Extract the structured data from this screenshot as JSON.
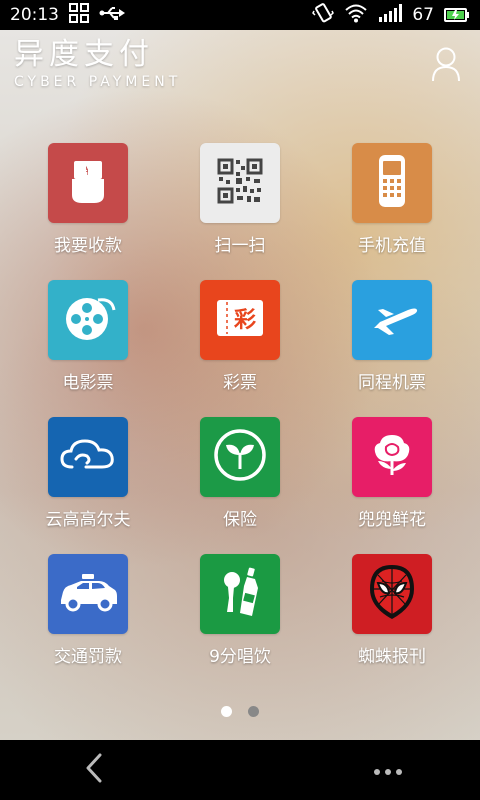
{
  "status_bar": {
    "time": "20:13",
    "battery_level": "67",
    "icons": [
      "qr-grid-icon",
      "usb-icon",
      "vibrate-icon",
      "wifi-icon",
      "signal-icon",
      "battery-icon"
    ]
  },
  "header": {
    "title": "异度支付",
    "subtitle": "CYBER PAYMENT",
    "user_icon": "user-icon"
  },
  "tiles": [
    {
      "label": "我要收款",
      "icon": "hand-money-icon",
      "color": "#c54a4a"
    },
    {
      "label": "扫一扫",
      "icon": "qr-code-icon",
      "color": "#ececec"
    },
    {
      "label": "手机充值",
      "icon": "mobile-phone-icon",
      "color": "#d88c48"
    },
    {
      "label": "电影票",
      "icon": "film-reel-icon",
      "color": "#33b1c9"
    },
    {
      "label": "彩票",
      "icon": "lottery-ticket-icon",
      "color": "#e8451d"
    },
    {
      "label": "同程机票",
      "icon": "airplane-icon",
      "color": "#2aa0df"
    },
    {
      "label": "云高高尔夫",
      "icon": "cloud-icon",
      "color": "#1565b1"
    },
    {
      "label": "保险",
      "icon": "leaf-icon",
      "color": "#1c9a47"
    },
    {
      "label": "兜兜鲜花",
      "icon": "rose-icon",
      "color": "#e71e67"
    },
    {
      "label": "交通罚款",
      "icon": "taxi-car-icon",
      "color": "#3b6bc8"
    },
    {
      "label": "9分唱饮",
      "icon": "mic-bottle-icon",
      "color": "#1b9a43"
    },
    {
      "label": "蜘蛛报刊",
      "icon": "spiderman-icon",
      "color": "#cf1e23"
    }
  ],
  "pagination": {
    "current": 1,
    "total": 2,
    "active_color": "#ffffff",
    "inactive_color": "#888888"
  },
  "nav": {
    "back_icon": "back-chevron-icon",
    "more_icon": "more-dots-icon"
  }
}
